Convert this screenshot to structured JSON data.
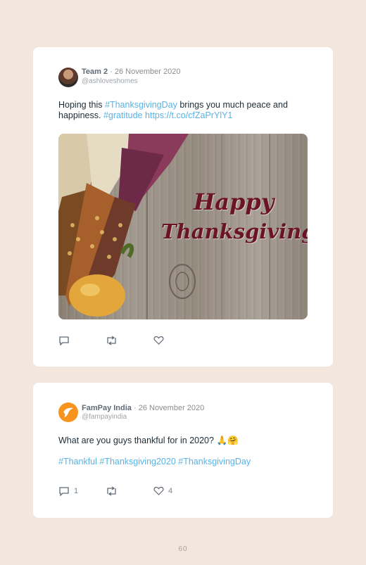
{
  "tweets": [
    {
      "author": "Team 2",
      "date": "· 26 November 2020",
      "handle": "@ashloveshomes",
      "text_part1": "Hoping this ",
      "hashtag1": "#ThanksgivingDay",
      "text_part2": " brings you much peace and happiness. ",
      "hashtag2": "#gratitude",
      "url": "https://t.co/cfZaPrYlY1",
      "image_text_line1": "Happy",
      "image_text_line2": "Thanksgiving",
      "reply_icon": "reply-icon",
      "retweet_icon": "retweet-icon",
      "like_icon": "heart-icon"
    },
    {
      "author": "FamPay India",
      "date": "· 26 November 2020",
      "handle": "@fampayindia",
      "text": "What are you guys thankful for in 2020? 🙏🤗",
      "hashtags": "#Thankful #Thanksgiving2020 #ThanksgivingDay",
      "reply_count": "1",
      "like_count": "4",
      "reply_icon": "reply-icon",
      "retweet_icon": "retweet-icon",
      "like_icon": "heart-icon"
    }
  ],
  "page_number": "60"
}
